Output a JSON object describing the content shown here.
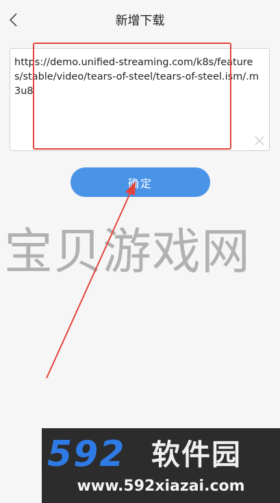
{
  "header": {
    "title": "新增下载",
    "back_icon": "chevron-left-icon"
  },
  "url_input": {
    "value": "https://demo.unified-streaming.com/k8s/features/stable/video/tears-of-steel/tears-of-steel.ism/.m3u8",
    "clear_icon": "close-icon"
  },
  "confirm_button": {
    "label": "确定"
  },
  "watermark": {
    "text": "宝贝游戏网"
  },
  "banner": {
    "number": "592",
    "name": "软件园",
    "url": "www.592xiazai.com"
  },
  "colors": {
    "accent": "#4a94e8",
    "annotation": "#e2433a",
    "banner_bg": "#2c2c2c",
    "banner_number": "#2f7be6"
  }
}
